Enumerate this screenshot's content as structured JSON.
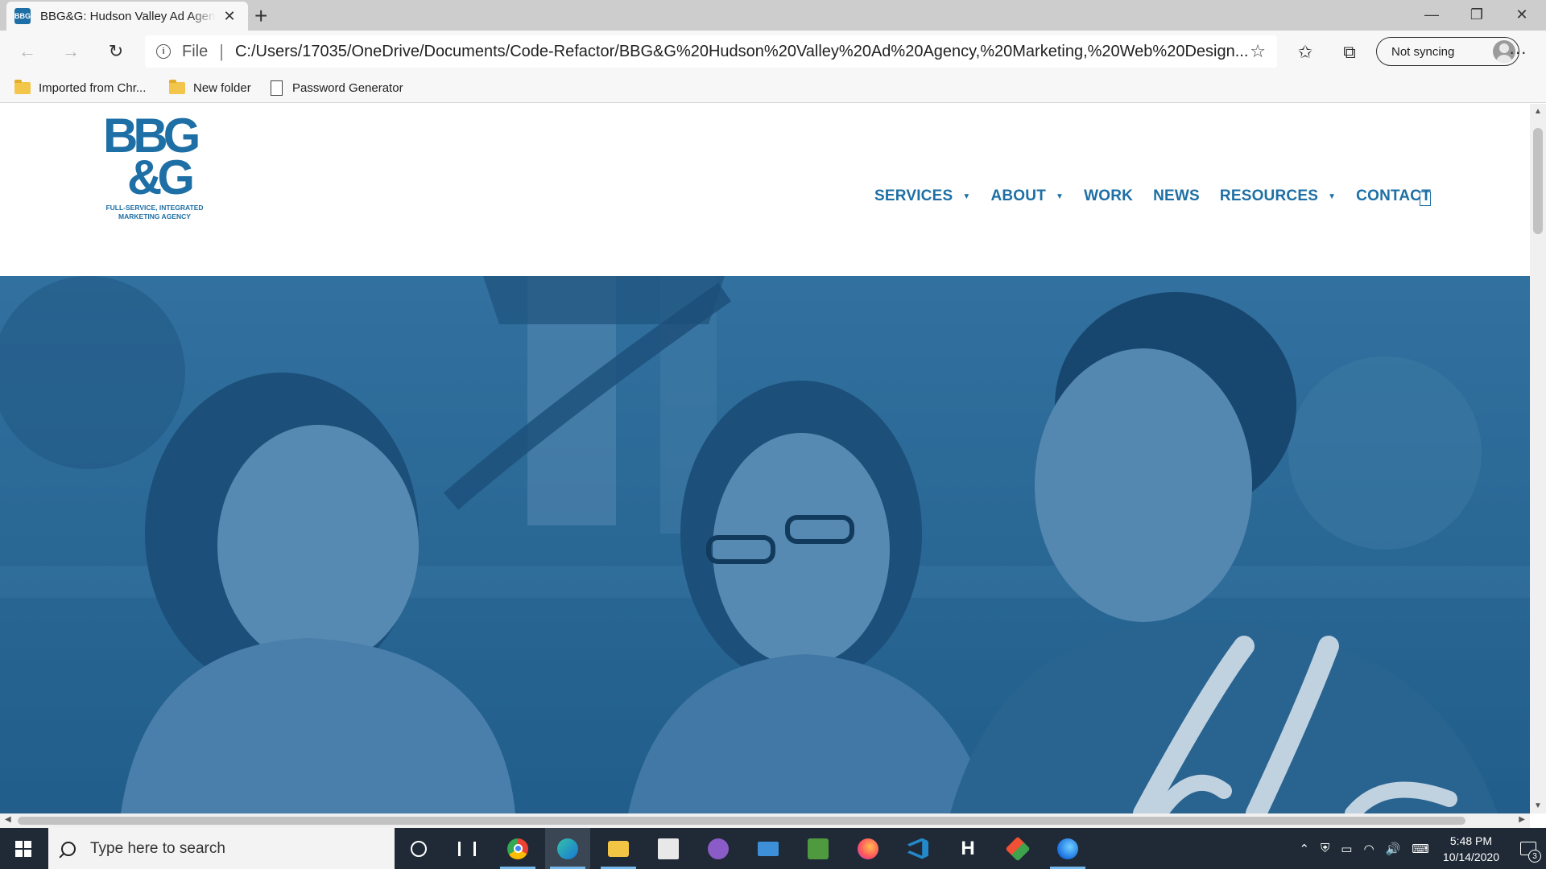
{
  "browser": {
    "tab": {
      "title": "BBG&G: Hudson Valley Ad Agency, Marketing, Web Design",
      "favicon_text": "BBG",
      "close_glyph": "✕"
    },
    "new_tab_glyph": "+",
    "window_controls": {
      "minimize": "—",
      "restore": "❐",
      "close": "✕"
    },
    "nav": {
      "back": "←",
      "forward": "→",
      "refresh": "↻"
    },
    "address": {
      "info_glyph": "i",
      "scheme": "File",
      "separator": "|",
      "url": "C:/Users/17035/OneDrive/Documents/Code-Refactor/BBG&G%20Hudson%20Valley%20Ad%20Agency,%20Marketing,%20Web%20Design....",
      "favorite_glyph": "☆"
    },
    "toolbar_icons": {
      "favorites": "✩",
      "collections": "⧉",
      "more": "···"
    },
    "profile": {
      "label": "Not syncing"
    },
    "bookmarks": [
      {
        "label": "Imported from Chr...",
        "icon": "folder-icon"
      },
      {
        "label": "New folder",
        "icon": "folder-icon"
      },
      {
        "label": "Password Generator",
        "icon": "page-icon"
      }
    ]
  },
  "site": {
    "logo": {
      "mark_line1": "BBG",
      "mark_line2": "&G",
      "tagline_line1": "FULL-SERVICE, INTEGRATED",
      "tagline_line2": "MARKETING AGENCY"
    },
    "nav": [
      {
        "label": "SERVICES",
        "has_dropdown": true
      },
      {
        "label": "ABOUT",
        "has_dropdown": true
      },
      {
        "label": "WORK",
        "has_dropdown": false
      },
      {
        "label": "NEWS",
        "has_dropdown": false
      },
      {
        "label": "RESOURCES",
        "has_dropdown": true
      },
      {
        "label": "CONTACT",
        "has_dropdown": false
      }
    ],
    "caret_glyph": "▼",
    "hero": {
      "overlay_color": "#2a6896",
      "image": "three people smiling looking down"
    },
    "brand_color": "#1d6fa5"
  },
  "scrollbar": {
    "up": "▲",
    "down": "▼",
    "left": "◀",
    "right": "▶"
  },
  "taskbar": {
    "search_placeholder": "Type here to search",
    "apps": [
      "cortana",
      "task-view",
      "chrome",
      "edge",
      "file-explorer",
      "store",
      "github-desktop",
      "mail",
      "excel",
      "firefox",
      "vscode",
      "hyper",
      "git",
      "firefox-dev"
    ],
    "tray": {
      "chevron": "⌃",
      "time": "5:48 PM",
      "date": "10/14/2020",
      "notifications": "3"
    }
  }
}
